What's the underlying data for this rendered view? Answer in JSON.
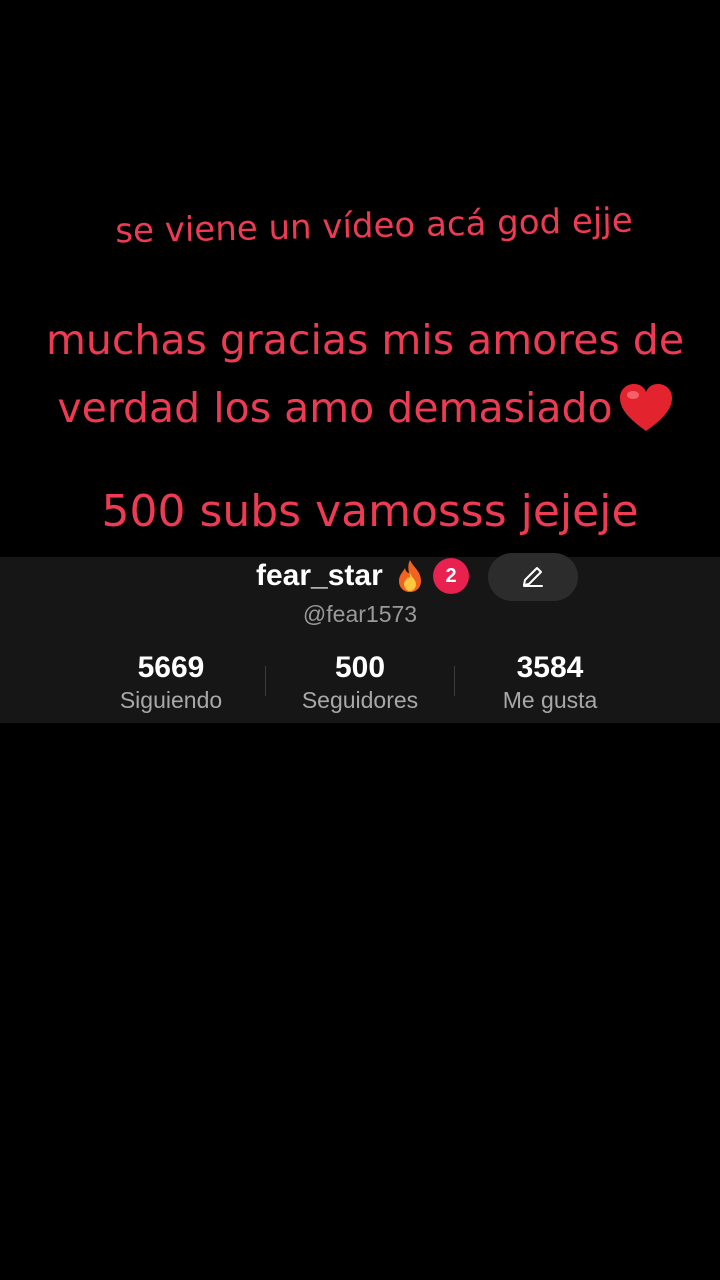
{
  "captions": {
    "line1": "se viene un vídeo acá god ejje",
    "line2a": "muchas gracias mis amores de",
    "line2b": "verdad los amo demasiado",
    "line3": "500 subs vamosss jejeje"
  },
  "profile": {
    "username": "fear_star",
    "notification_count": "2",
    "handle": "@fear1573",
    "stats": [
      {
        "value": "5669",
        "label": "Siguiendo"
      },
      {
        "value": "500",
        "label": "Seguidores"
      },
      {
        "value": "3584",
        "label": "Me gusta"
      }
    ]
  },
  "colors": {
    "caption": "#ee3a52",
    "badge": "#e8214e",
    "strip_background": "#161616"
  },
  "icons": {
    "heart": "heart-emoji-icon",
    "fire": "fire-emoji-icon",
    "edit": "pencil-icon"
  }
}
